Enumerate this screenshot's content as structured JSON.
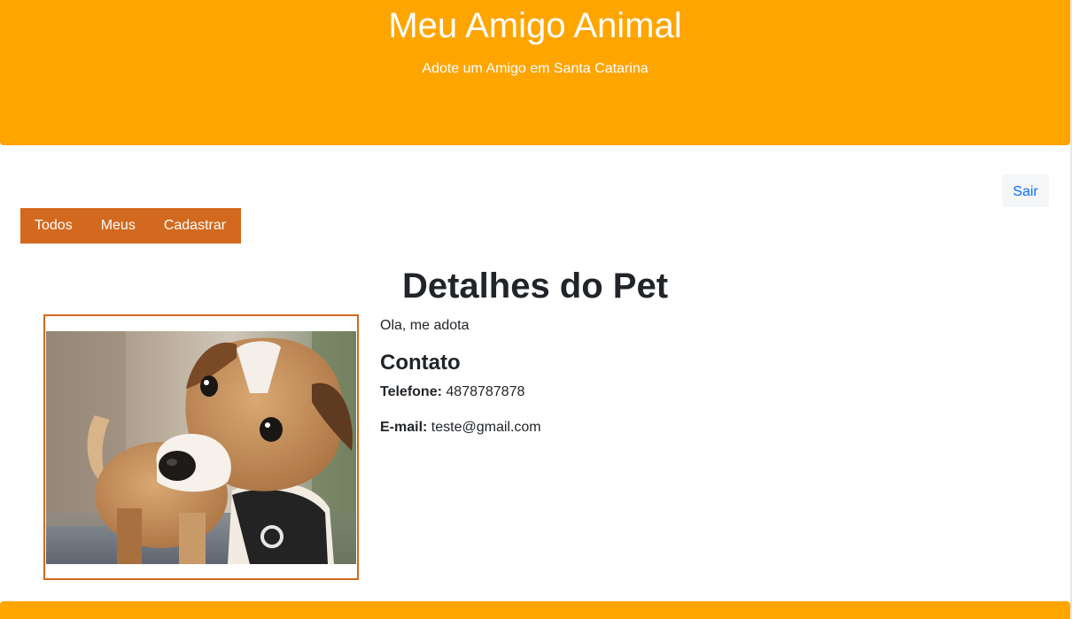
{
  "header": {
    "title": "Meu Amigo Animal",
    "subtitle": "Adote um Amigo em Santa Catarina"
  },
  "toolbar": {
    "logout_label": "Sair"
  },
  "nav": {
    "items": [
      {
        "label": "Todos"
      },
      {
        "label": "Meus"
      },
      {
        "label": "Cadastrar"
      }
    ]
  },
  "main": {
    "title": "Detalhes do Pet",
    "pet": {
      "description": "Ola, me adota",
      "contact_heading": "Contato",
      "phone_label": "Telefone:",
      "phone": "4878787878",
      "email_label": "E-mail:",
      "email": "teste@gmail.com"
    }
  },
  "colors": {
    "header": "#ffa500",
    "nav": "#d2691e",
    "frame": "#d2691e",
    "link": "#0d6efd"
  }
}
